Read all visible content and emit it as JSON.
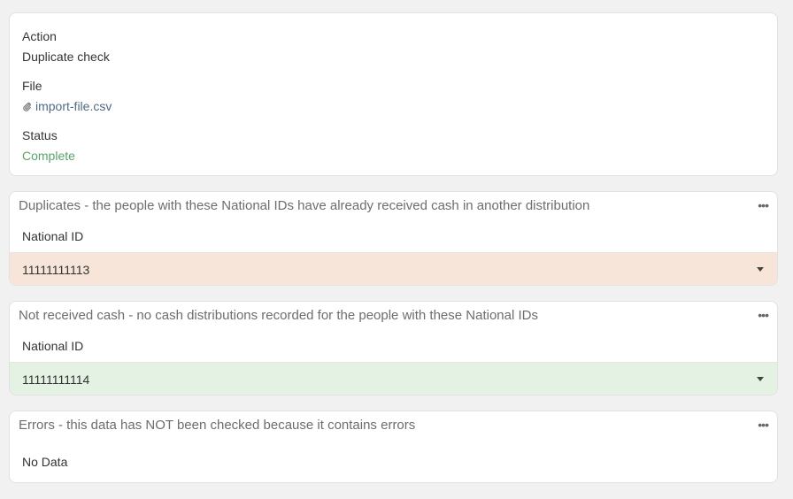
{
  "details": {
    "action_label": "Action",
    "action_value": "Duplicate check",
    "file_label": "File",
    "file_name": "import-file.csv",
    "file_icon": "paperclip-icon",
    "status_label": "Status",
    "status_value": "Complete",
    "status_color": "#59a36b"
  },
  "duplicates": {
    "title": "Duplicates - the people with these National IDs have already received cash in another distribution",
    "column": "National ID",
    "rows": [
      "11111111113"
    ],
    "row_color": "#f7e5da"
  },
  "not_received": {
    "title": "Not received cash - no cash distributions recorded for the people with these National IDs",
    "column": "National ID",
    "rows": [
      "11111111114"
    ],
    "row_color": "#e3f2e3"
  },
  "errors": {
    "title": "Errors - this data has NOT been checked because it contains errors",
    "empty_text": "No Data"
  },
  "icons": {
    "more": "more-horizontal-icon",
    "caret": "caret-down-icon"
  },
  "more_glyph": "•••"
}
